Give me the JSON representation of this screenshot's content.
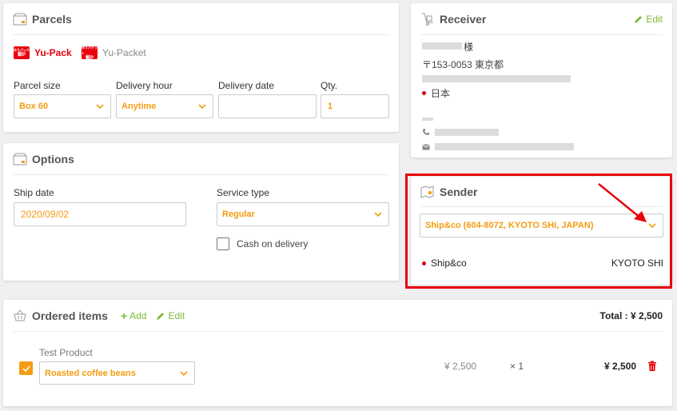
{
  "parcels": {
    "title": "Parcels",
    "carriers": [
      {
        "name": "Yu-Pack",
        "badge_top": "ゆうパック",
        "badge": "郵P",
        "active": true
      },
      {
        "name": "Yu-Packet",
        "badge_top": "ゆうパケット",
        "badge": "郵P",
        "active": false
      }
    ],
    "fields": {
      "parcel_size_label": "Parcel size",
      "parcel_size_value": "Box 60",
      "delivery_hour_label": "Delivery hour",
      "delivery_hour_value": "Anytime",
      "delivery_date_label": "Delivery date",
      "delivery_date_value": "",
      "qty_label": "Qty.",
      "qty_value": "1"
    }
  },
  "options": {
    "title": "Options",
    "ship_date_label": "Ship date",
    "ship_date_value": "2020/09/02",
    "service_type_label": "Service type",
    "service_type_value": "Regular",
    "cash_on_delivery_label": "Cash on delivery"
  },
  "receiver": {
    "title": "Receiver",
    "edit_label": "Edit",
    "honorific": "様",
    "postal_line": "〒153-0053 東京都",
    "country": "日本"
  },
  "sender": {
    "title": "Sender",
    "selected": "Ship&co (604-8072, KYOTO SHI, JAPAN)",
    "name": "Ship&co",
    "city": "KYOTO SHI"
  },
  "ordered_items": {
    "title": "Ordered items",
    "add_label": "Add",
    "edit_label": "Edit",
    "total_label": "Total : ¥ 2,500",
    "items": [
      {
        "product": "Test Product",
        "variant": "Roasted coffee beans",
        "unit_price": "¥ 2,500",
        "quantity": "× 1",
        "line_total": "¥ 2,500"
      }
    ]
  },
  "colors": {
    "accent": "#f39c12",
    "green": "#7cbb3a",
    "highlight": "#e8000b",
    "red_dot": "#d0021b"
  }
}
